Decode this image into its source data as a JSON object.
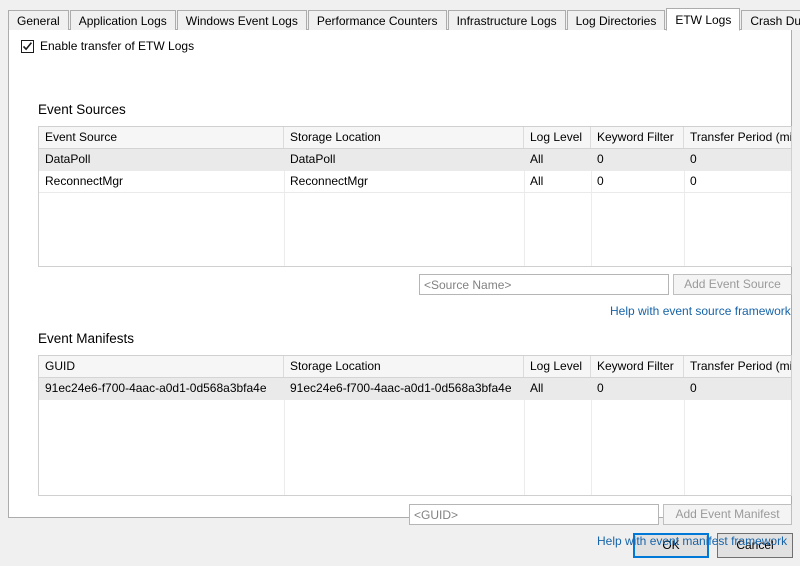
{
  "dialog": {
    "tabs": [
      {
        "label": "General",
        "selected": false
      },
      {
        "label": "Application Logs",
        "selected": false
      },
      {
        "label": "Windows Event Logs",
        "selected": false
      },
      {
        "label": "Performance Counters",
        "selected": false
      },
      {
        "label": "Infrastructure Logs",
        "selected": false
      },
      {
        "label": "Log Directories",
        "selected": false
      },
      {
        "label": "ETW Logs",
        "selected": true
      },
      {
        "label": "Crash Dumps",
        "selected": false
      }
    ],
    "enable_checkbox": {
      "label": "Enable transfer of ETW Logs",
      "checked": true,
      "icon": "checkmark-icon"
    },
    "buttons": {
      "ok": "OK",
      "cancel": "Cancel"
    },
    "accent_color": "#0078d7",
    "link_color": "#1764a8"
  },
  "event_sources": {
    "heading": "Event Sources",
    "columns": [
      "Event Source",
      "Storage Location",
      "Log Level",
      "Keyword Filter",
      "Transfer Period (min)"
    ],
    "rows": [
      {
        "selected": true,
        "cells": [
          "DataPoll",
          "DataPoll",
          "All",
          "0",
          "0"
        ]
      },
      {
        "selected": false,
        "cells": [
          "ReconnectMgr",
          "ReconnectMgr",
          "All",
          "0",
          "0"
        ]
      }
    ],
    "input": {
      "value": "",
      "placeholder": "<Source Name>"
    },
    "add_button": {
      "label": "Add Event Source",
      "enabled": false
    },
    "help_link": "Help with event source framework"
  },
  "event_manifests": {
    "heading": "Event Manifests",
    "columns": [
      "GUID",
      "Storage Location",
      "Log Level",
      "Keyword Filter",
      "Transfer Period (min)"
    ],
    "rows": [
      {
        "selected": true,
        "cells": [
          "91ec24e6-f700-4aac-a0d1-0d568a3bfa4e",
          "91ec24e6-f700-4aac-a0d1-0d568a3bfa4e",
          "All",
          "0",
          "0"
        ]
      }
    ],
    "input": {
      "value": "",
      "placeholder": "<GUID>"
    },
    "add_button": {
      "label": "Add Event Manifest",
      "enabled": false
    },
    "help_link": "Help with event manifest framework"
  }
}
